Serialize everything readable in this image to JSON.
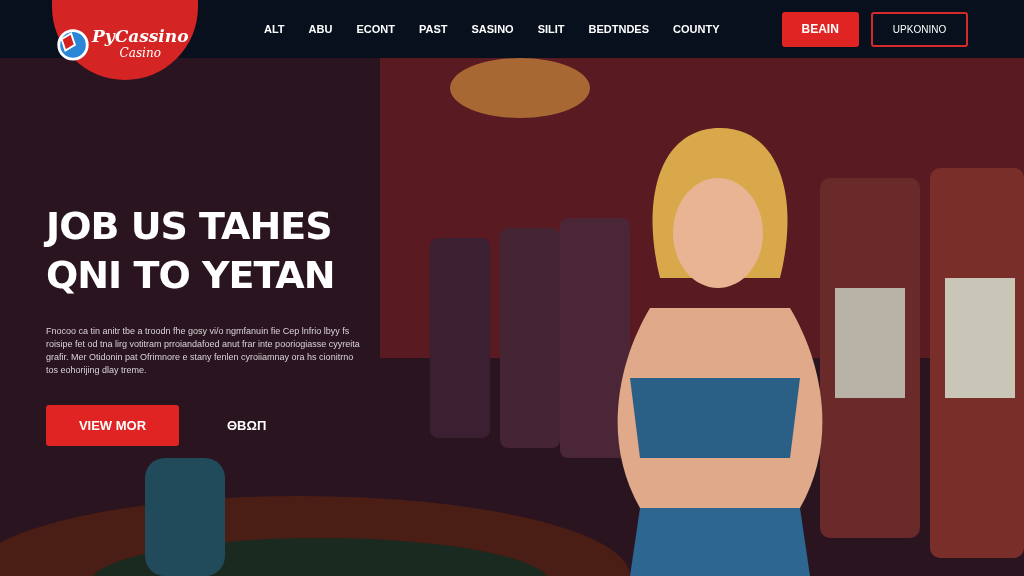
{
  "header": {
    "logo": {
      "title": "PyCassino",
      "subtitle": "Casino"
    },
    "nav": [
      {
        "label": "ALT"
      },
      {
        "label": "ABU"
      },
      {
        "label": "ECONT"
      },
      {
        "label": "PAST"
      },
      {
        "label": "SASINO"
      },
      {
        "label": "SILIT"
      },
      {
        "label": "BEDTNDES"
      },
      {
        "label": "COUNTY"
      }
    ],
    "buttons": [
      {
        "label": "BEAIN",
        "kind": "primary"
      },
      {
        "label": "UPKONINO",
        "kind": "outline"
      }
    ]
  },
  "hero": {
    "headline": [
      "JOB US TAHES",
      "QNI TO YETAN"
    ],
    "paragraph": "Fnocoo ca tin anitr tbe a troodn fhe gosy vi/o ngmfanuin fie Cep lnfrio lbyy fs roisipe fet od tna lirg votitram prroiandafoed anut frar inte pooriogiasse cyyreita grafir. Mer Otidonin pat Ofrimnore e stany fenlen cyroiiamnay ora hs cionitrno tos eohorijing dlay treme.",
    "buttons": [
      {
        "label": "VIEW MOR",
        "kind": "primary"
      },
      {
        "label": "ΘΒΩΠ",
        "kind": "link"
      }
    ]
  }
}
